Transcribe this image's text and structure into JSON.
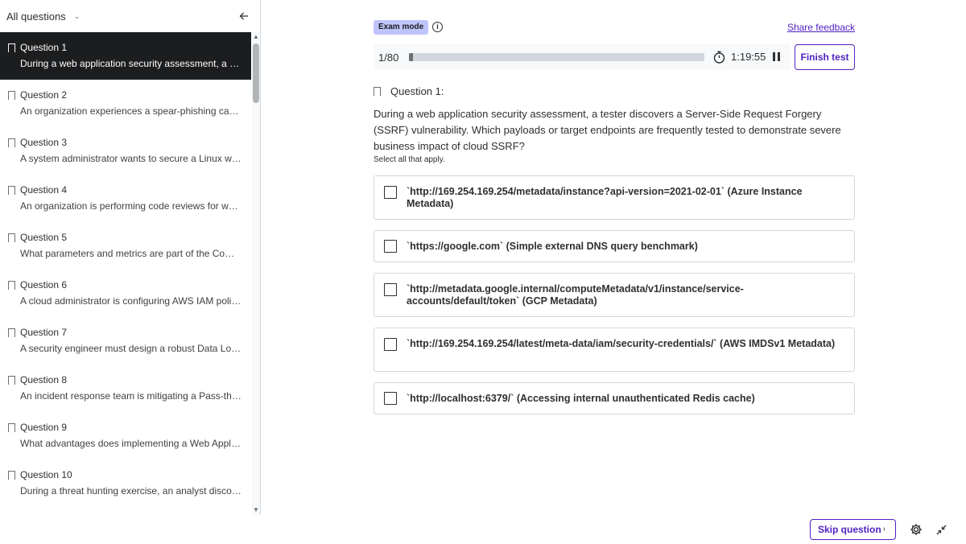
{
  "sidebar": {
    "title": "All questions",
    "questions": [
      {
        "label": "Question 1",
        "text": "During a web application security assessment, a tester discovers a Server-Side Request Forgery (SSRF) vulnerability."
      },
      {
        "label": "Question 2",
        "text": "An organization experiences a spear-phishing campaign"
      },
      {
        "label": "Question 3",
        "text": "A system administrator wants to secure a Linux web server"
      },
      {
        "label": "Question 4",
        "text": "An organization is performing code reviews for web applications"
      },
      {
        "label": "Question 5",
        "text": "What parameters and metrics are part of the Common Vulnerability Scoring System"
      },
      {
        "label": "Question 6",
        "text": "A cloud administrator is configuring AWS IAM policies. Which"
      },
      {
        "label": "Question 7",
        "text": "A security engineer must design a robust Data Loss Prevention"
      },
      {
        "label": "Question 8",
        "text": "An incident response team is mitigating a Pass-the-Hash attack"
      },
      {
        "label": "Question 9",
        "text": "What advantages does implementing a Web Application Firewall"
      },
      {
        "label": "Question 10",
        "text": "During a threat hunting exercise, an analyst discovers a suspicious"
      }
    ]
  },
  "header": {
    "mode_badge": "Exam mode",
    "share_feedback": "Share feedback",
    "count": "1/80",
    "progress": 0.0125,
    "timer": "1:19:55",
    "finish_label": "Finish test"
  },
  "question": {
    "label": "Question 1:",
    "body": "During a web application security assessment, a tester discovers a Server-Side Request Forgery (SSRF) vulnerability. Which payloads or target endpoints are frequently tested to demonstrate severe business impact of cloud SSRF?",
    "hint": "Select all that apply.",
    "options": [
      "`http://169.254.169.254/metadata/instance?api-version=2021-02-01` (Azure Instance Metadata)",
      "`https://google.com` (Simple external DNS query benchmark)",
      "`http://metadata.google.internal/computeMetadata/v1/instance/service-accounts/default/token` (GCP Metadata)",
      "`http://169.254.169.254/latest/meta-data/iam/security-credentials/` (AWS IMDSv1 Metadata)",
      "`http://localhost:6379/` (Accessing internal unauthenticated Redis cache)"
    ]
  },
  "footer": {
    "skip_label": "Skip question"
  },
  "icons": {
    "collapse": "arrow-left-icon",
    "info": "info-icon",
    "timer": "stopwatch-icon",
    "pause": "pause-icon",
    "settings": "gear-icon",
    "exit_fullscreen": "shrink-icon"
  },
  "colors": {
    "accent": "#5022c3",
    "badge": "#c0c4fc",
    "active_item": "#1c1d1f"
  }
}
